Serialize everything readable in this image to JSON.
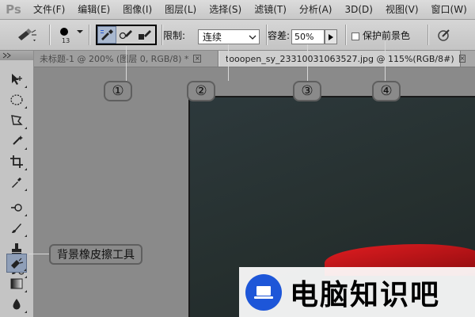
{
  "app": {
    "logo": "Ps"
  },
  "menu": {
    "items": [
      "文件(F)",
      "编辑(E)",
      "图像(I)",
      "图层(L)",
      "选择(S)",
      "滤镜(T)",
      "分析(A)",
      "3D(D)",
      "视图(V)",
      "窗口(W)"
    ]
  },
  "options": {
    "brush_size": "13",
    "limit_label": "限制:",
    "limit_value": "连续",
    "tolerance_label": "容差:",
    "tolerance_value": "50%",
    "protect_label": "保护前景色",
    "protect_checked": false
  },
  "tabs": [
    {
      "label": "未标题-1 @ 200% (图层 0, RGB/8) *",
      "active": false
    },
    {
      "label": "tooopen_sy_23310031063527.jpg @ 115%(RGB/8#)",
      "active": true
    }
  ],
  "callouts": {
    "c1": "①",
    "c2": "②",
    "c3": "③",
    "c4": "④",
    "tool_name": "背景橡皮擦工具"
  },
  "watermark": {
    "text": "电脑知识吧"
  },
  "colors": {
    "accent_blue": "#1d56d8",
    "rose_red": "#e11d21",
    "canvas_dark": "#26302f"
  }
}
